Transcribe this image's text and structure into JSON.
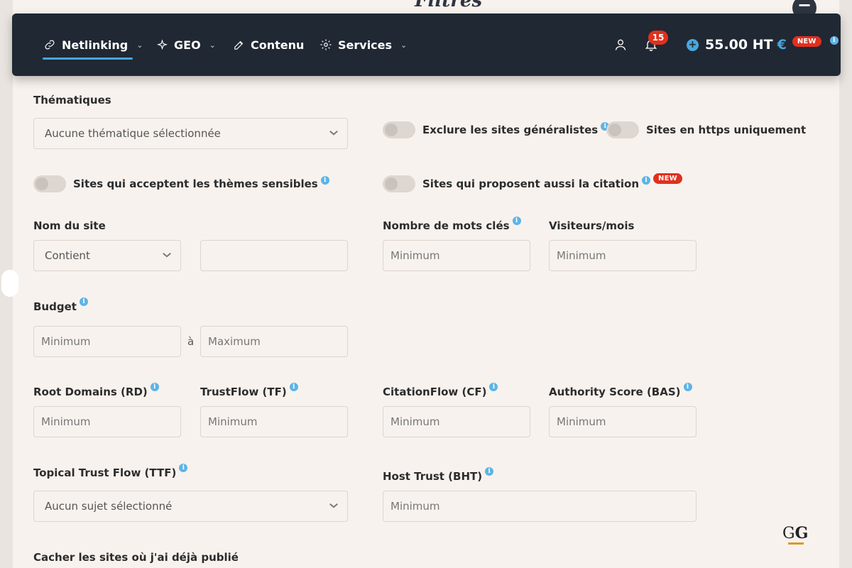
{
  "background": {
    "title_fragment": "Filtres"
  },
  "nav": {
    "items": [
      {
        "label": "Netlinking",
        "has_dropdown": true,
        "active": true
      },
      {
        "label": "GEO",
        "has_dropdown": true
      },
      {
        "label": "Contenu",
        "has_dropdown": false
      },
      {
        "label": "Services",
        "has_dropdown": true
      }
    ],
    "notifications_count": "15",
    "credit_amount": "55.00 HT",
    "credit_currency": "€",
    "credit_badge": "NEW",
    "colors": {
      "bar": "#202833",
      "accent": "#4aa6dd",
      "badge": "#e0301e"
    }
  },
  "form": {
    "thematiques": {
      "label": "Thématiques",
      "placeholder": "Aucune thématique sélectionnée"
    },
    "toggles": {
      "exclure_generalistes": "Exclure les sites généralistes",
      "https_only": "Sites en https uniquement",
      "themes_sensibles": "Sites qui acceptent les thèmes sensibles",
      "citation": "Sites qui proposent aussi la citation",
      "citation_badge": "NEW"
    },
    "nom_du_site": {
      "label": "Nom du site",
      "mode": "Contient",
      "value": ""
    },
    "mots_cles": {
      "label": "Nombre de mots clés",
      "placeholder": "Minimum"
    },
    "visiteurs": {
      "label": "Visiteurs/mois",
      "placeholder": "Minimum"
    },
    "budget": {
      "label": "Budget",
      "min_placeholder": "Minimum",
      "separator": "à",
      "max_placeholder": "Maximum"
    },
    "rd": {
      "label": "Root Domains (RD)",
      "placeholder": "Minimum"
    },
    "tf": {
      "label": "TrustFlow (TF)",
      "placeholder": "Minimum"
    },
    "cf": {
      "label": "CitationFlow (CF)",
      "placeholder": "Minimum"
    },
    "bas": {
      "label": "Authority Score (BAS)",
      "placeholder": "Minimum"
    },
    "ttf": {
      "label": "Topical Trust Flow (TTF)",
      "placeholder": "Aucun sujet sélectionné"
    },
    "bht": {
      "label": "Host Trust (BHT)",
      "placeholder": "Minimum"
    },
    "cacher": {
      "label": "Cacher les sites où j'ai déjà publié"
    }
  },
  "watermark": {
    "text_1": "G",
    "text_2": "G"
  }
}
